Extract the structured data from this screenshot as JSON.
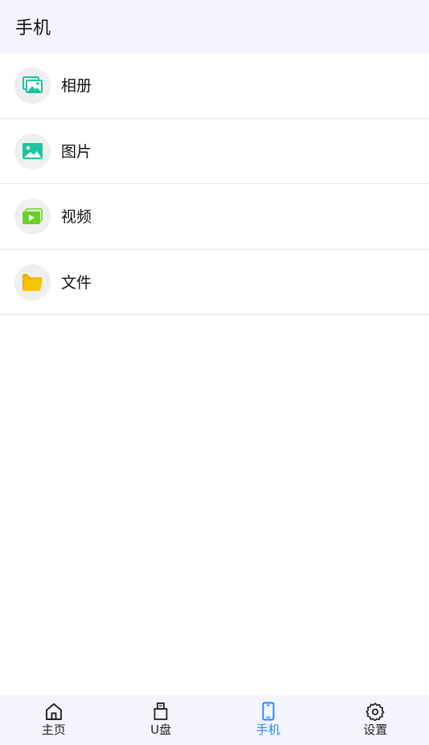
{
  "header": {
    "title": "手机"
  },
  "list": {
    "items": [
      {
        "label": "相册",
        "icon": "album-icon",
        "color": "#1cc5a0"
      },
      {
        "label": "图片",
        "icon": "image-icon",
        "color": "#1cc5a0"
      },
      {
        "label": "视频",
        "icon": "video-icon",
        "color": "#6bd128"
      },
      {
        "label": "文件",
        "icon": "folder-icon",
        "color": "#f7c600"
      }
    ]
  },
  "tabbar": {
    "tabs": [
      {
        "label": "主页",
        "icon": "home-icon",
        "active": false
      },
      {
        "label": "U盘",
        "icon": "usb-drive-icon",
        "active": false
      },
      {
        "label": "手机",
        "icon": "phone-icon",
        "active": true
      },
      {
        "label": "设置",
        "icon": "gear-icon",
        "active": false
      }
    ],
    "active_color": "#1e88f5",
    "inactive_color": "#222222"
  }
}
